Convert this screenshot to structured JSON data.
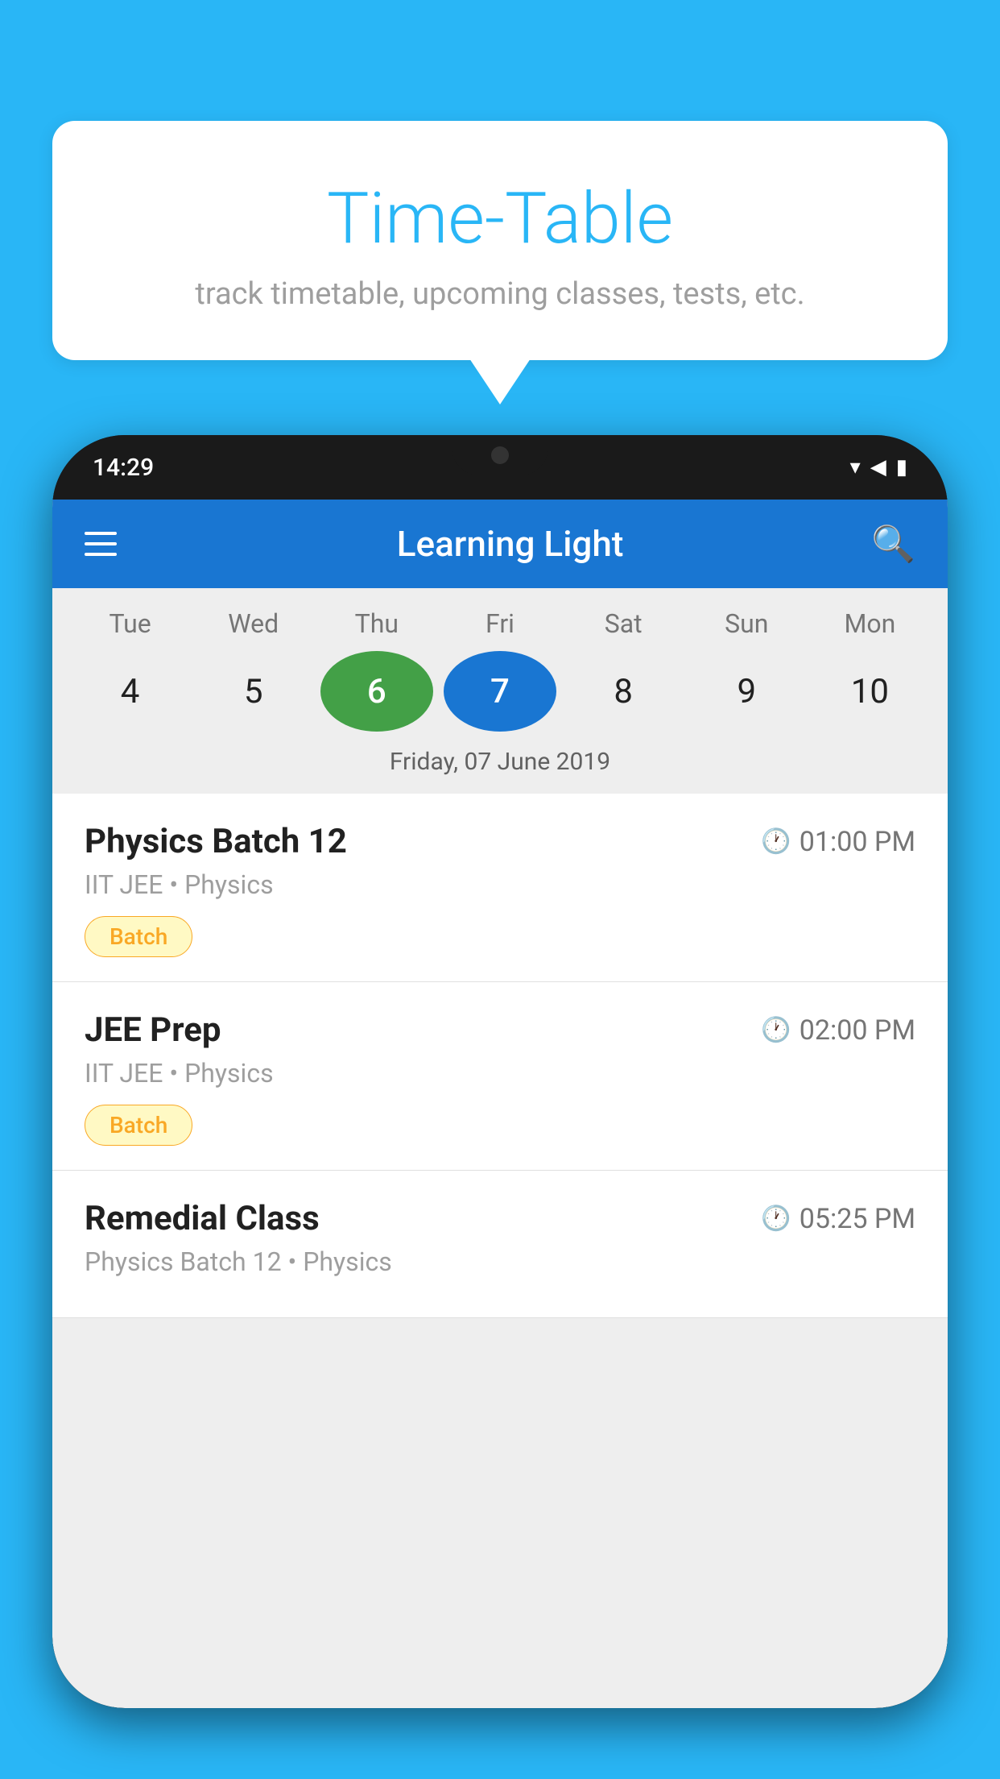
{
  "background_color": "#29B6F6",
  "bubble": {
    "title": "Time-Table",
    "subtitle": "track timetable, upcoming classes, tests, etc."
  },
  "phone": {
    "status_bar": {
      "time": "14:29",
      "icons": [
        "▾",
        "◀",
        "▮"
      ]
    },
    "app_header": {
      "title": "Learning Light"
    },
    "calendar": {
      "weekdays": [
        "Tue",
        "Wed",
        "Thu",
        "Fri",
        "Sat",
        "Sun",
        "Mon"
      ],
      "dates": [
        {
          "num": "4",
          "state": "normal"
        },
        {
          "num": "5",
          "state": "normal"
        },
        {
          "num": "6",
          "state": "today"
        },
        {
          "num": "7",
          "state": "selected"
        },
        {
          "num": "8",
          "state": "normal"
        },
        {
          "num": "9",
          "state": "normal"
        },
        {
          "num": "10",
          "state": "normal"
        }
      ],
      "selected_date_label": "Friday, 07 June 2019"
    },
    "schedule": [
      {
        "title": "Physics Batch 12",
        "time": "01:00 PM",
        "subtitle": "IIT JEE • Physics",
        "badge": "Batch"
      },
      {
        "title": "JEE Prep",
        "time": "02:00 PM",
        "subtitle": "IIT JEE • Physics",
        "badge": "Batch"
      },
      {
        "title": "Remedial Class",
        "time": "05:25 PM",
        "subtitle": "Physics Batch 12 • Physics",
        "badge": null
      }
    ]
  }
}
